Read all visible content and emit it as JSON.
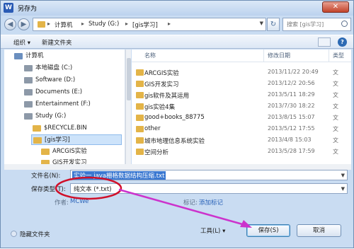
{
  "window": {
    "title": "另存为",
    "app_icon": "W",
    "close_label": "✕"
  },
  "navigation": {
    "breadcrumb": [
      "计算机",
      "Study (G:)",
      "[gis学习]"
    ],
    "search_placeholder": "搜索 [gis学习]"
  },
  "toolbar": {
    "organize_label": "组织 ▾",
    "new_folder_label": "新建文件夹"
  },
  "sidebar": {
    "items": [
      {
        "label": "计算机",
        "icon": "computer-icon"
      },
      {
        "label": "本地磁盘 (C:)",
        "icon": "drive-icon"
      },
      {
        "label": "Software (D:)",
        "icon": "drive-icon"
      },
      {
        "label": "Documents (E:)",
        "icon": "drive-icon"
      },
      {
        "label": "Entertainment (F:)",
        "icon": "drive-icon"
      },
      {
        "label": "Study (G:)",
        "icon": "drive-icon"
      },
      {
        "label": "$RECYCLE.BIN",
        "icon": "folder-icon"
      },
      {
        "label": "[gis学习]",
        "icon": "folder-icon"
      },
      {
        "label": "ARCGIS实验",
        "icon": "folder-icon"
      },
      {
        "label": "GIS开发实习",
        "icon": "folder-icon"
      }
    ]
  },
  "file_list": {
    "columns": [
      "名称",
      "修改日期",
      "类型"
    ],
    "rows": [
      {
        "name": "ARCGIS实验",
        "date": "2013/11/22 20:49",
        "type": "文"
      },
      {
        "name": "GIS开发实习",
        "date": "2013/12/2 20:56",
        "type": "文"
      },
      {
        "name": "gis软件及其运用",
        "date": "2013/5/11 18:29",
        "type": "文"
      },
      {
        "name": "gis实验4集",
        "date": "2013/7/30 18:22",
        "type": "文"
      },
      {
        "name": "good+books_88775",
        "date": "2013/8/15 15:07",
        "type": "文"
      },
      {
        "name": "other",
        "date": "2013/5/12 17:55",
        "type": "文"
      },
      {
        "name": "城市地理信息系统实验",
        "date": "2013/4/8 15:03",
        "type": "文"
      },
      {
        "name": "空间分析",
        "date": "2013/5/28 17:59",
        "type": "文"
      }
    ]
  },
  "form": {
    "filename_label": "文件名(N):",
    "filename_value": "实验一 java栅格数据结构压缩.txt",
    "filetype_label": "保存类型(T):",
    "filetype_value": "纯文本 (*.txt)",
    "author_label": "作者:",
    "author_value": "MCWe",
    "tags_label": "标记:",
    "tags_value": "添加标记"
  },
  "footer": {
    "hide_folders_label": "隐藏文件夹",
    "tools_label": "工具(L) ▾",
    "save_label": "保存(S)",
    "cancel_label": "取消"
  },
  "annotation": {
    "highlight_color": "#d0102a",
    "arrow_color": "#cc33cc"
  }
}
